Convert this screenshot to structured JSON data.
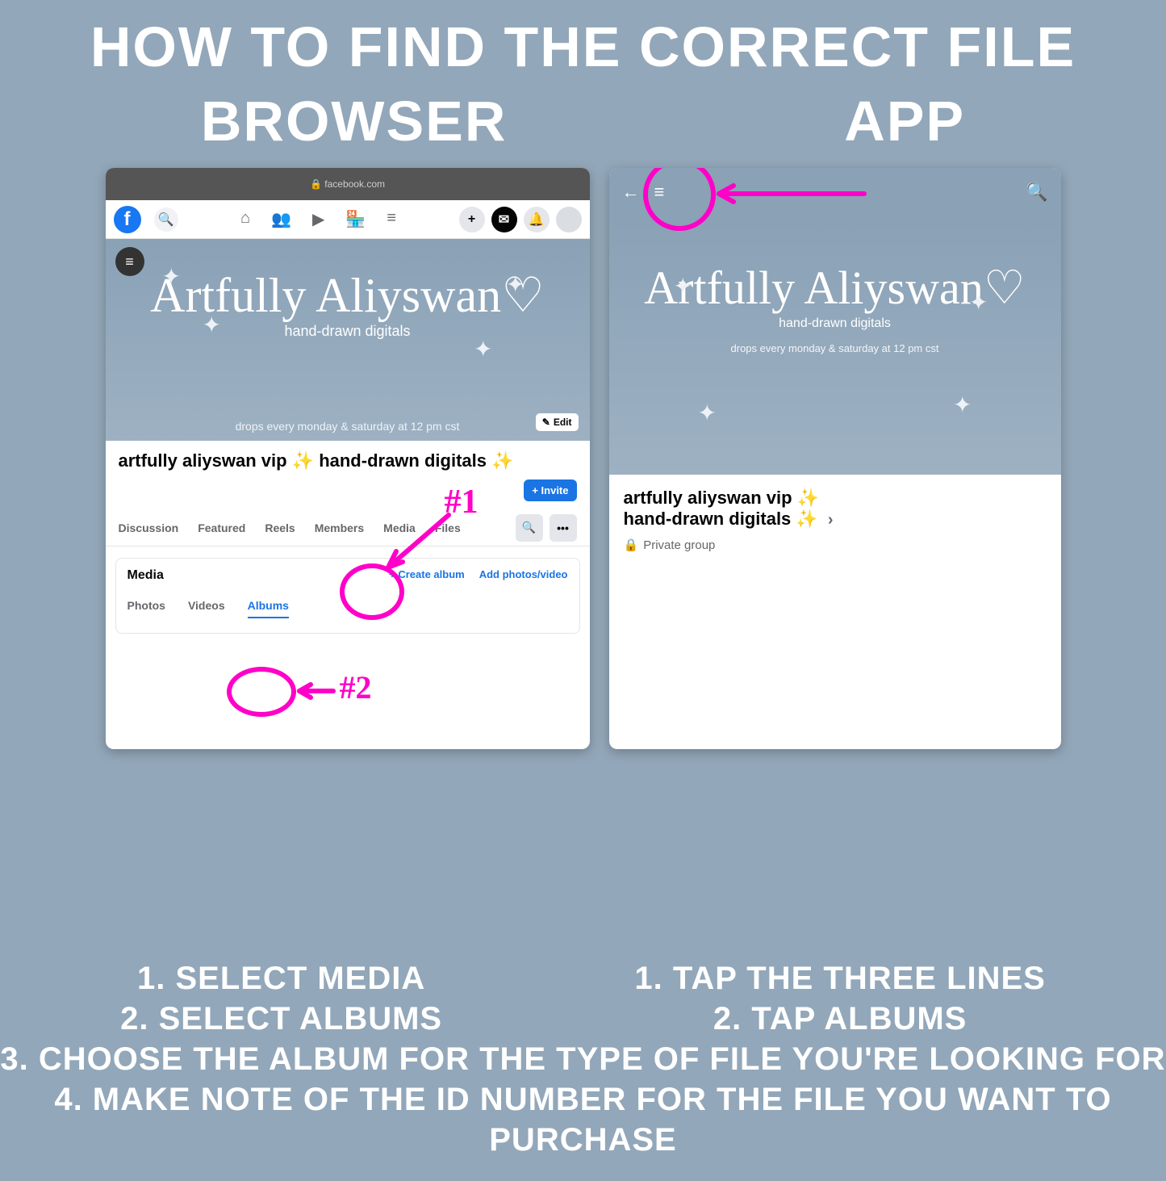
{
  "title": "HOW TO FIND THE CORRECT FILE",
  "col_labels": {
    "left": "BROWSER",
    "right": "APP"
  },
  "browser": {
    "url": "facebook.com",
    "group_title": "artfully aliyswan vip ✨ hand-drawn digitals ✨",
    "cover": {
      "brand": "Artfully Aliyswan♡",
      "tagline": "hand-drawn digitals",
      "drops": "drops every monday & saturday at 12 pm cst"
    },
    "edit": "Edit",
    "invite": "+ Invite",
    "tabs": [
      "Discussion",
      "Featured",
      "Reels",
      "Members",
      "Media",
      "Files"
    ],
    "media_heading": "Media",
    "media_actions": {
      "create": "+  Create album",
      "add": "Add photos/video"
    },
    "media_tabs": [
      "Photos",
      "Videos",
      "Albums"
    ]
  },
  "app": {
    "cover": {
      "brand": "Artfully Aliyswan♡",
      "tagline": "hand-drawn digitals",
      "drops": "drops every monday & saturday at 12 pm cst"
    },
    "group_title_l1": "artfully aliyswan vip ✨",
    "group_title_l2": "hand-drawn digitals ✨",
    "privacy": "Private group"
  },
  "annotations": {
    "n1": "#1",
    "n2": "#2"
  },
  "instructions": {
    "left": [
      "1. SELECT MEDIA",
      "2. SELECT ALBUMS"
    ],
    "right": [
      "1. TAP THE THREE LINES",
      "2. TAP ALBUMS"
    ],
    "shared": [
      "3. CHOOSE THE ALBUM FOR THE TYPE OF FILE YOU'RE LOOKING FOR",
      "4. MAKE NOTE OF THE ID NUMBER FOR THE FILE YOU WANT TO PURCHASE"
    ]
  }
}
